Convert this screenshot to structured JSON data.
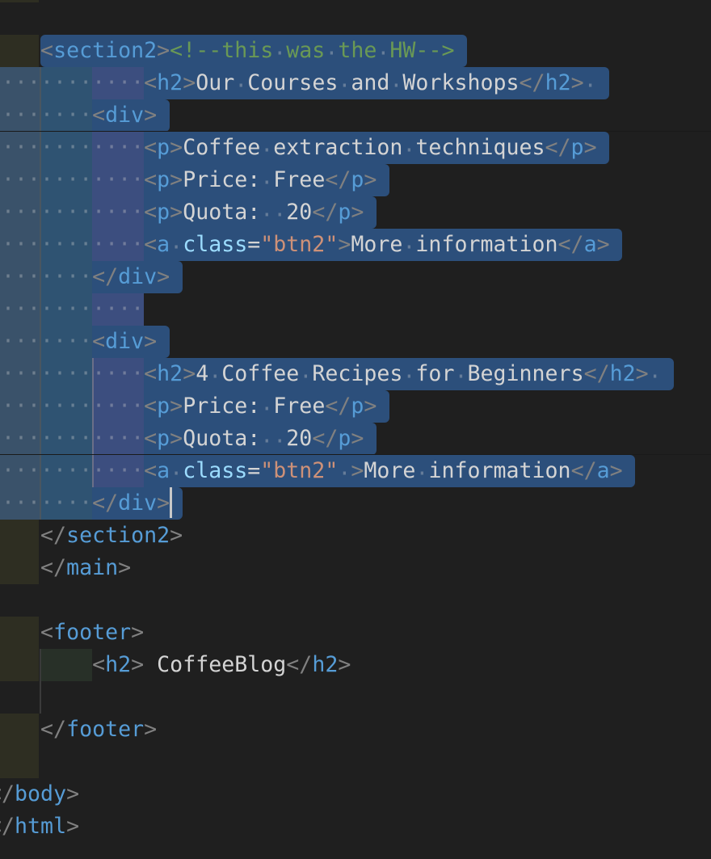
{
  "editor": {
    "colors": {
      "background": "#1f1f1f",
      "selection": "#2c4f7b",
      "tag": "#569cd6",
      "bracket": "#808080",
      "text": "#d4d4d4",
      "comment": "#6a9955",
      "attribute": "#9cdcfe",
      "string": "#ce9178"
    },
    "lines": [
      {
        "indent": 0,
        "selected": false,
        "tokens": []
      },
      {
        "indent": 4,
        "selected": true,
        "tokens": [
          [
            "br",
            "<"
          ],
          [
            "tag",
            "section2"
          ],
          [
            "br",
            ">"
          ],
          [
            "cm",
            "<!--this was the HW-->"
          ]
        ]
      },
      {
        "indent": 12,
        "selected": true,
        "tokens": [
          [
            "br",
            "<"
          ],
          [
            "tag",
            "h2"
          ],
          [
            "br",
            ">"
          ],
          [
            "txt",
            "Our Courses and Workshops"
          ],
          [
            "br",
            "</"
          ],
          [
            "tag",
            "h2"
          ],
          [
            "br",
            ">"
          ],
          [
            "txt",
            " "
          ]
        ]
      },
      {
        "indent": 8,
        "selected": true,
        "tokens": [
          [
            "br",
            "<"
          ],
          [
            "tag",
            "div"
          ],
          [
            "br",
            ">"
          ]
        ]
      },
      {
        "indent": 12,
        "selected": true,
        "tokens": [
          [
            "br",
            "<"
          ],
          [
            "tag",
            "p"
          ],
          [
            "br",
            ">"
          ],
          [
            "txt",
            "Coffee extraction techniques"
          ],
          [
            "br",
            "</"
          ],
          [
            "tag",
            "p"
          ],
          [
            "br",
            ">"
          ]
        ]
      },
      {
        "indent": 12,
        "selected": true,
        "tokens": [
          [
            "br",
            "<"
          ],
          [
            "tag",
            "p"
          ],
          [
            "br",
            ">"
          ],
          [
            "txt",
            "Price: Free"
          ],
          [
            "br",
            "</"
          ],
          [
            "tag",
            "p"
          ],
          [
            "br",
            ">"
          ]
        ]
      },
      {
        "indent": 12,
        "selected": true,
        "tokens": [
          [
            "br",
            "<"
          ],
          [
            "tag",
            "p"
          ],
          [
            "br",
            ">"
          ],
          [
            "txt",
            "Quota:  20"
          ],
          [
            "br",
            "</"
          ],
          [
            "tag",
            "p"
          ],
          [
            "br",
            ">"
          ]
        ]
      },
      {
        "indent": 12,
        "selected": true,
        "tokens": [
          [
            "br",
            "<"
          ],
          [
            "tag",
            "a"
          ],
          [
            "txt",
            " "
          ],
          [
            "attr",
            "class"
          ],
          [
            "txt",
            "="
          ],
          [
            "str",
            "\"btn2\""
          ],
          [
            "br",
            ">"
          ],
          [
            "txt",
            "More information"
          ],
          [
            "br",
            "</"
          ],
          [
            "tag",
            "a"
          ],
          [
            "br",
            ">"
          ]
        ]
      },
      {
        "indent": 8,
        "selected": true,
        "tokens": [
          [
            "br",
            "</"
          ],
          [
            "tag",
            "div"
          ],
          [
            "br",
            ">"
          ]
        ]
      },
      {
        "indent": 12,
        "selected": true,
        "tokens": []
      },
      {
        "indent": 8,
        "selected": true,
        "tokens": [
          [
            "br",
            "<"
          ],
          [
            "tag",
            "div"
          ],
          [
            "br",
            ">"
          ]
        ]
      },
      {
        "indent": 12,
        "selected": true,
        "tokens": [
          [
            "br",
            "<"
          ],
          [
            "tag",
            "h2"
          ],
          [
            "br",
            ">"
          ],
          [
            "txt",
            "4 Coffee Recipes for Beginners"
          ],
          [
            "br",
            "</"
          ],
          [
            "tag",
            "h2"
          ],
          [
            "br",
            ">"
          ],
          [
            "txt",
            " "
          ]
        ]
      },
      {
        "indent": 12,
        "selected": true,
        "tokens": [
          [
            "br",
            "<"
          ],
          [
            "tag",
            "p"
          ],
          [
            "br",
            ">"
          ],
          [
            "txt",
            "Price: Free"
          ],
          [
            "br",
            "</"
          ],
          [
            "tag",
            "p"
          ],
          [
            "br",
            ">"
          ]
        ]
      },
      {
        "indent": 12,
        "selected": true,
        "tokens": [
          [
            "br",
            "<"
          ],
          [
            "tag",
            "p"
          ],
          [
            "br",
            ">"
          ],
          [
            "txt",
            "Quota:  20"
          ],
          [
            "br",
            "</"
          ],
          [
            "tag",
            "p"
          ],
          [
            "br",
            ">"
          ]
        ]
      },
      {
        "indent": 12,
        "selected": true,
        "tokens": [
          [
            "br",
            "<"
          ],
          [
            "tag",
            "a"
          ],
          [
            "txt",
            " "
          ],
          [
            "attr",
            "class"
          ],
          [
            "txt",
            "="
          ],
          [
            "str",
            "\"btn2\""
          ],
          [
            "txt",
            " "
          ],
          [
            "br",
            ">"
          ],
          [
            "txt",
            "More information"
          ],
          [
            "br",
            "</"
          ],
          [
            "tag",
            "a"
          ],
          [
            "br",
            ">"
          ]
        ]
      },
      {
        "indent": 8,
        "selected": true,
        "tokens": [
          [
            "br",
            "</"
          ],
          [
            "tag",
            "div"
          ],
          [
            "br",
            ">"
          ]
        ]
      },
      {
        "indent": 4,
        "selected": false,
        "tokens": [
          [
            "br",
            "</"
          ],
          [
            "tag",
            "section2"
          ],
          [
            "br",
            ">"
          ]
        ]
      },
      {
        "indent": 4,
        "selected": false,
        "tokens": [
          [
            "br",
            "</"
          ],
          [
            "tag",
            "main"
          ],
          [
            "br",
            ">"
          ]
        ]
      },
      {
        "indent": 0,
        "selected": false,
        "tokens": []
      },
      {
        "indent": 4,
        "selected": false,
        "tokens": [
          [
            "br",
            "<"
          ],
          [
            "tag",
            "footer"
          ],
          [
            "br",
            ">"
          ]
        ]
      },
      {
        "indent": 8,
        "selected": false,
        "tokens": [
          [
            "br",
            "<"
          ],
          [
            "tag",
            "h2"
          ],
          [
            "br",
            ">"
          ],
          [
            "txt",
            " CoffeeBlog"
          ],
          [
            "br",
            "</"
          ],
          [
            "tag",
            "h2"
          ],
          [
            "br",
            ">"
          ]
        ]
      },
      {
        "indent": 0,
        "selected": false,
        "tokens": []
      },
      {
        "indent": 4,
        "selected": false,
        "tokens": [
          [
            "br",
            "</"
          ],
          [
            "tag",
            "footer"
          ],
          [
            "br",
            ">"
          ]
        ]
      },
      {
        "indent": 0,
        "selected": false,
        "tokens": []
      },
      {
        "indent": 0,
        "selected": false,
        "tokens": [
          [
            "br",
            "<"
          ],
          [
            "br",
            "/"
          ],
          [
            "tag",
            "body"
          ],
          [
            "br",
            ">"
          ]
        ]
      },
      {
        "indent": 0,
        "selected": false,
        "tokens": [
          [
            "br",
            "<"
          ],
          [
            "br",
            "/"
          ],
          [
            "tag",
            "html"
          ],
          [
            "br",
            ">"
          ]
        ]
      }
    ]
  }
}
